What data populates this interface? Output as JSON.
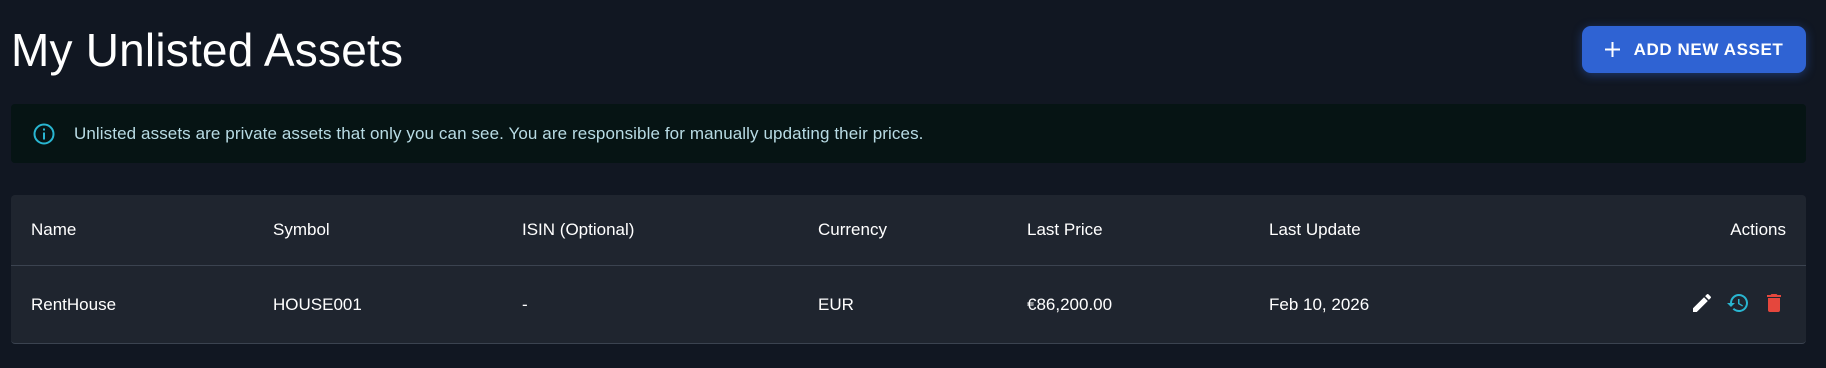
{
  "header": {
    "title": "My Unlisted Assets",
    "add_button_label": "ADD NEW ASSET"
  },
  "info_banner": {
    "icon": "info-icon",
    "text": "Unlisted assets are private assets that only you can see. You are responsible for manually updating their prices."
  },
  "table": {
    "columns": {
      "name": "Name",
      "symbol": "Symbol",
      "isin": "ISIN (Optional)",
      "currency": "Currency",
      "last_price": "Last Price",
      "last_update": "Last Update",
      "actions": "Actions"
    },
    "rows": [
      {
        "name": "RentHouse",
        "symbol": "HOUSE001",
        "isin": "-",
        "currency": "EUR",
        "last_price": "€86,200.00",
        "last_update": "Feb 10, 2026",
        "actions": [
          "edit-icon",
          "history-icon",
          "delete-icon"
        ]
      }
    ]
  },
  "colors": {
    "background": "#111722",
    "primary_button": "#2f63d3",
    "info_banner_bg": "#061414",
    "info_accent": "#29b6d1",
    "table_bg": "#1f252f",
    "delete_red": "#e5473d"
  }
}
